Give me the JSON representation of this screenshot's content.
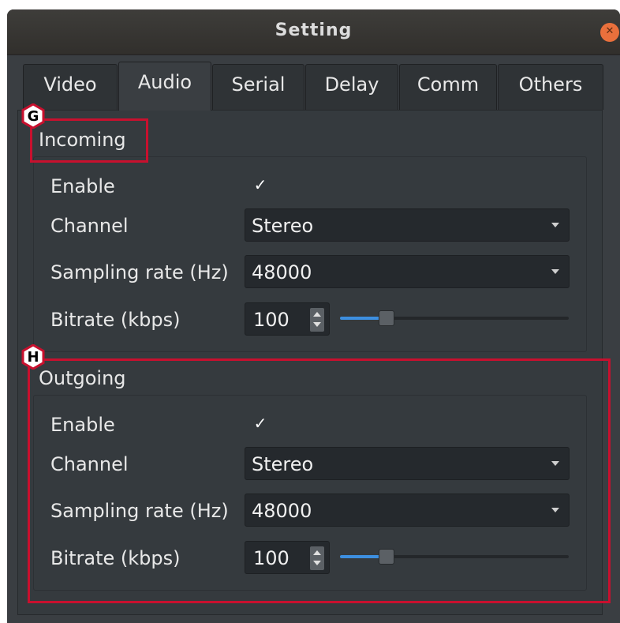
{
  "window": {
    "title": "Setting"
  },
  "tabs": [
    {
      "label": "Video",
      "active": false
    },
    {
      "label": "Audio",
      "active": true
    },
    {
      "label": "Serial",
      "active": false
    },
    {
      "label": "Delay",
      "active": false
    },
    {
      "label": "Comm",
      "active": false
    },
    {
      "label": "Others",
      "active": false
    }
  ],
  "incoming": {
    "title": "Incoming",
    "enable_label": "Enable",
    "enabled": true,
    "channel_label": "Channel",
    "channel_value": "Stereo",
    "sampling_label": "Sampling rate (Hz)",
    "sampling_value": "48000",
    "bitrate_label": "Bitrate (kbps)",
    "bitrate_value": "100",
    "bitrate_slider_fraction": 0.18
  },
  "outgoing": {
    "title": "Outgoing",
    "enable_label": "Enable",
    "enabled": true,
    "channel_label": "Channel",
    "channel_value": "Stereo",
    "sampling_label": "Sampling rate (Hz)",
    "sampling_value": "48000",
    "bitrate_label": "Bitrate (kbps)",
    "bitrate_value": "100",
    "bitrate_slider_fraction": 0.18
  },
  "annotations": {
    "marker_g": "G",
    "marker_h": "H",
    "callout_color": "#c8102e"
  },
  "colors": {
    "slider_fill": "#3d8fe0",
    "close_button": "#e9703c"
  },
  "icons": {
    "close": "close-icon",
    "checkmark": "checkmark-icon",
    "dropdown": "chevron-down-icon",
    "spin_up": "spin-up-icon",
    "spin_down": "spin-down-icon"
  }
}
